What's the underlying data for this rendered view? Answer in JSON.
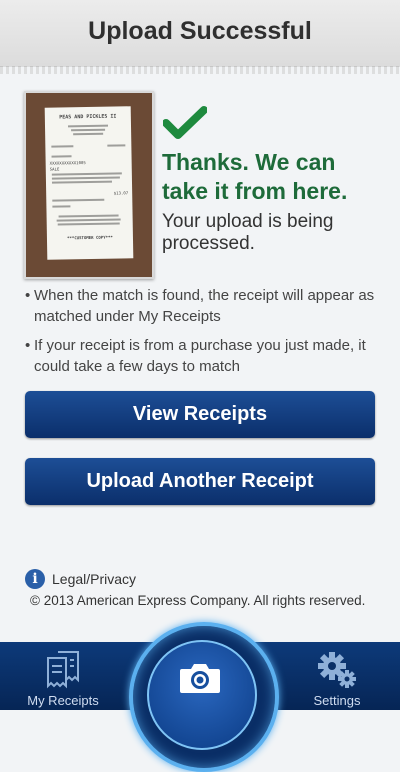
{
  "header": {
    "title": "Upload Successful"
  },
  "receipt_image": {
    "store": "PEAS AND PICKLES II",
    "card": "XXXXXXXXXXX1005",
    "sale": "SALE",
    "total": "$13.07",
    "footer": "***CUSTOMER COPY***"
  },
  "status": {
    "headline": "Thanks. We can take it from here.",
    "message": "Your upload is being processed."
  },
  "notes": [
    "When the match is found, the receipt will appear as matched under My Receipts",
    "If your receipt is from a purchase you just made, it could take a few days to match"
  ],
  "buttons": {
    "view_receipts": "View Receipts",
    "upload_another": "Upload Another Receipt"
  },
  "footer": {
    "legal_label": "Legal/Privacy",
    "copyright": "© 2013 American Express Company. All rights reserved."
  },
  "tabbar": {
    "my_receipts": "My Receipts",
    "settings": "Settings",
    "camera_icon": "camera-icon"
  },
  "colors": {
    "accent_green": "#1e6b3a",
    "button_blue": "#0b2f6b",
    "tabbar_blue": "#062555",
    "ring_blue": "#5bb0ef"
  }
}
